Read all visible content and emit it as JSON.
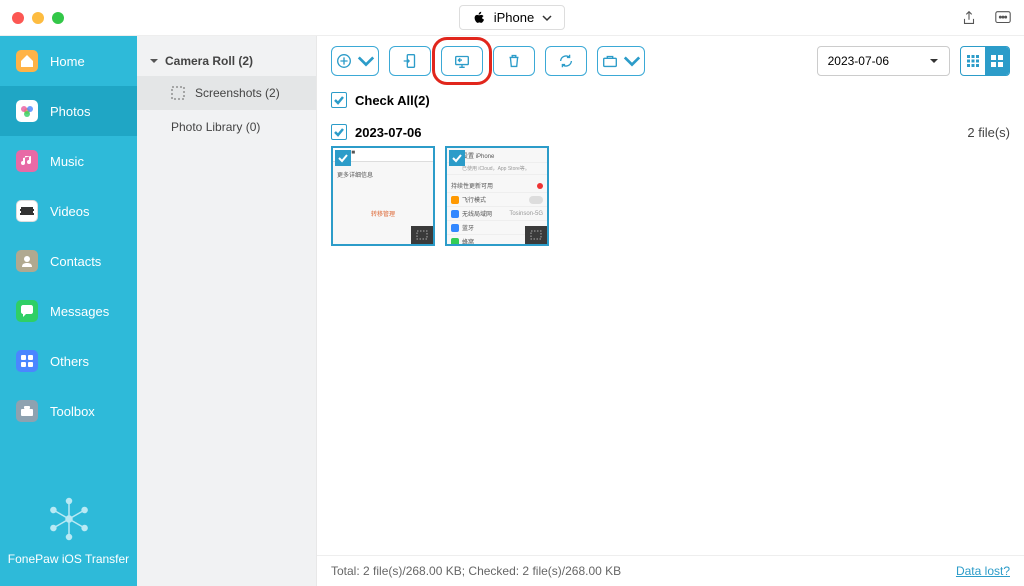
{
  "titlebar": {
    "device": "iPhone"
  },
  "sidebar": {
    "items": [
      {
        "label": "Home",
        "icon": "home",
        "bg": "#ffb347"
      },
      {
        "label": "Photos",
        "icon": "photos",
        "bg": "#6b5bd3"
      },
      {
        "label": "Music",
        "icon": "music",
        "bg": "#e86aa6"
      },
      {
        "label": "Videos",
        "icon": "videos",
        "bg": "#ffffff"
      },
      {
        "label": "Contacts",
        "icon": "contacts",
        "bg": "#b0a990"
      },
      {
        "label": "Messages",
        "icon": "messages",
        "bg": "#2fcf65"
      },
      {
        "label": "Others",
        "icon": "others",
        "bg": "#4a86ff"
      },
      {
        "label": "Toolbox",
        "icon": "toolbox",
        "bg": "#8ea2b0"
      }
    ],
    "brand": "FonePaw iOS Transfer"
  },
  "albums": {
    "header": "Camera Roll (2)",
    "items": [
      {
        "label": "Screenshots (2)"
      },
      {
        "label": "Photo Library (0)"
      }
    ]
  },
  "toolbar": {
    "date_filter": "2023-07-06"
  },
  "checkall": {
    "label": "Check All(2)"
  },
  "sections": [
    {
      "date": "2023-07-06",
      "count": "2 file(s)"
    }
  ],
  "status": {
    "text": "Total: 2 file(s)/268.00 KB; Checked: 2 file(s)/268.00 KB",
    "link": "Data lost?"
  }
}
